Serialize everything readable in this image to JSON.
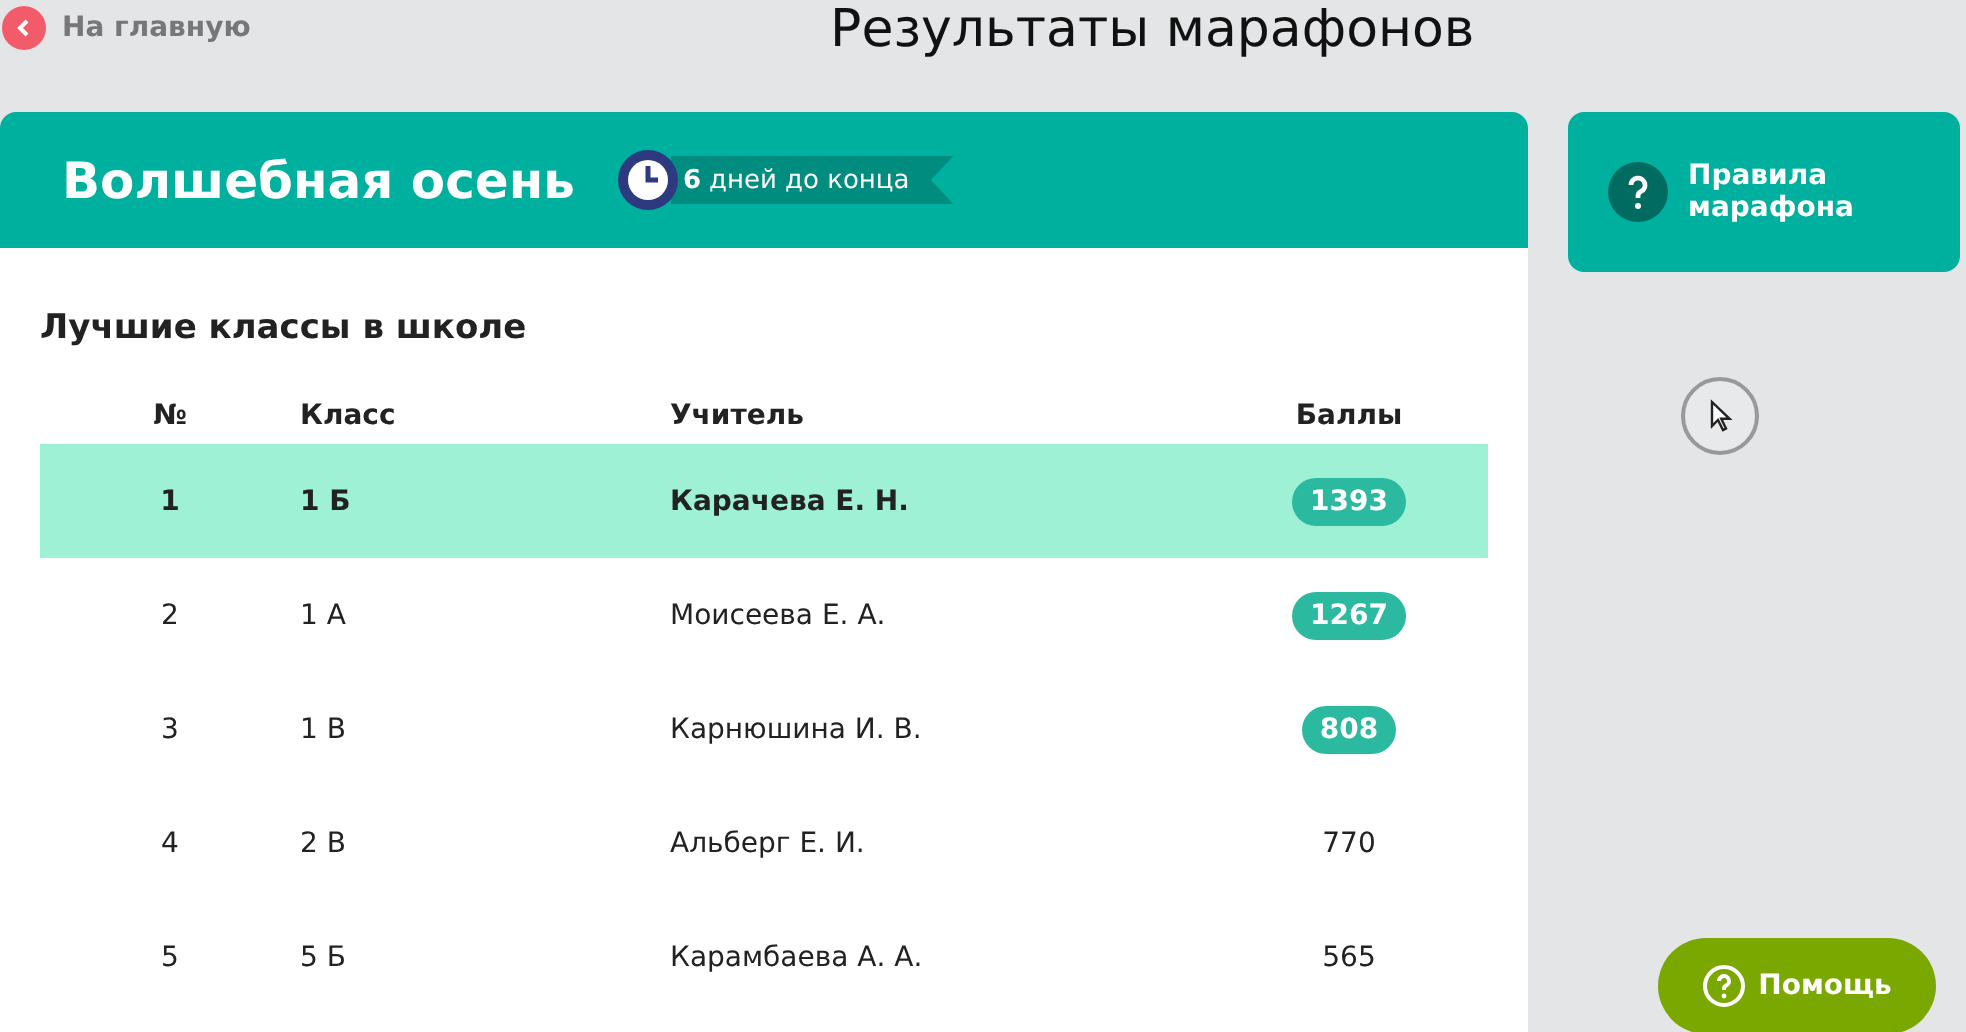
{
  "back_link": {
    "label": "На главную"
  },
  "page_title": "Результаты марафонов",
  "marathon": {
    "title": "Волшебная осень",
    "countdown_number": "6",
    "countdown_text": "дней до конца"
  },
  "rules_button": {
    "label": "Правила марафона"
  },
  "ranking": {
    "title": "Лучшие классы в школе",
    "columns": [
      "№",
      "Класс",
      "Учитель",
      "Баллы"
    ],
    "rows": [
      {
        "rank": "1",
        "class": "1 Б",
        "teacher": "Карачева Е. Н.",
        "score": "1393",
        "highlighted": true,
        "score_badge": true
      },
      {
        "rank": "2",
        "class": "1 А",
        "teacher": "Моисеева Е. А.",
        "score": "1267",
        "highlighted": false,
        "score_badge": true
      },
      {
        "rank": "3",
        "class": "1 В",
        "teacher": "Карнюшина И. В.",
        "score": "808",
        "highlighted": false,
        "score_badge": true
      },
      {
        "rank": "4",
        "class": "2 В",
        "teacher": "Альберг Е. И.",
        "score": "770",
        "highlighted": false,
        "score_badge": false
      },
      {
        "rank": "5",
        "class": "5 Б",
        "teacher": "Карамбаева А. А.",
        "score": "565",
        "highlighted": false,
        "score_badge": false
      }
    ]
  },
  "help_button": {
    "label": "Помощь"
  }
}
